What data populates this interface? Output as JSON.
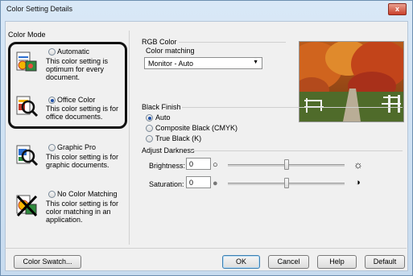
{
  "window": {
    "title": "Color Setting Details",
    "close_glyph": "x"
  },
  "color_mode": {
    "title": "Color Mode",
    "options": [
      {
        "label": "Automatic",
        "desc": "This color setting is optimum for every document.",
        "selected": false,
        "icon": "auto-document-icon"
      },
      {
        "label": "Office Color",
        "desc": "This color setting is for office documents.",
        "selected": true,
        "icon": "office-color-magnifier-icon"
      },
      {
        "label": "Graphic Pro",
        "desc": "This color setting is for graphic documents.",
        "selected": false,
        "icon": "graphic-pro-magnifier-icon"
      },
      {
        "label": "No Color Matching",
        "desc": "This color setting is for color matching in an application.",
        "selected": false,
        "icon": "no-color-matching-icon"
      }
    ]
  },
  "rgb_color": {
    "title": "RGB Color",
    "matching_label": "Color matching",
    "matching_value": "Monitor - Auto"
  },
  "black_finish": {
    "title": "Black Finish",
    "options": [
      {
        "label": "Auto",
        "selected": true
      },
      {
        "label": "Composite Black (CMYK)",
        "selected": false
      },
      {
        "label": "True Black (K)",
        "selected": false
      }
    ]
  },
  "adjust_darkness": {
    "title": "Adjust Darkness",
    "brightness_label": "Brightness:",
    "brightness_value": "0",
    "saturation_label": "Saturation:",
    "saturation_value": "0",
    "brightness_level": 0.5,
    "saturation_level": 0.5
  },
  "buttons": {
    "color_swatch": "Color Swatch...",
    "ok": "OK",
    "cancel": "Cancel",
    "help": "Help",
    "default": "Default"
  },
  "colors": {
    "accent": "#1d4fa8",
    "close": "#c9402b"
  }
}
